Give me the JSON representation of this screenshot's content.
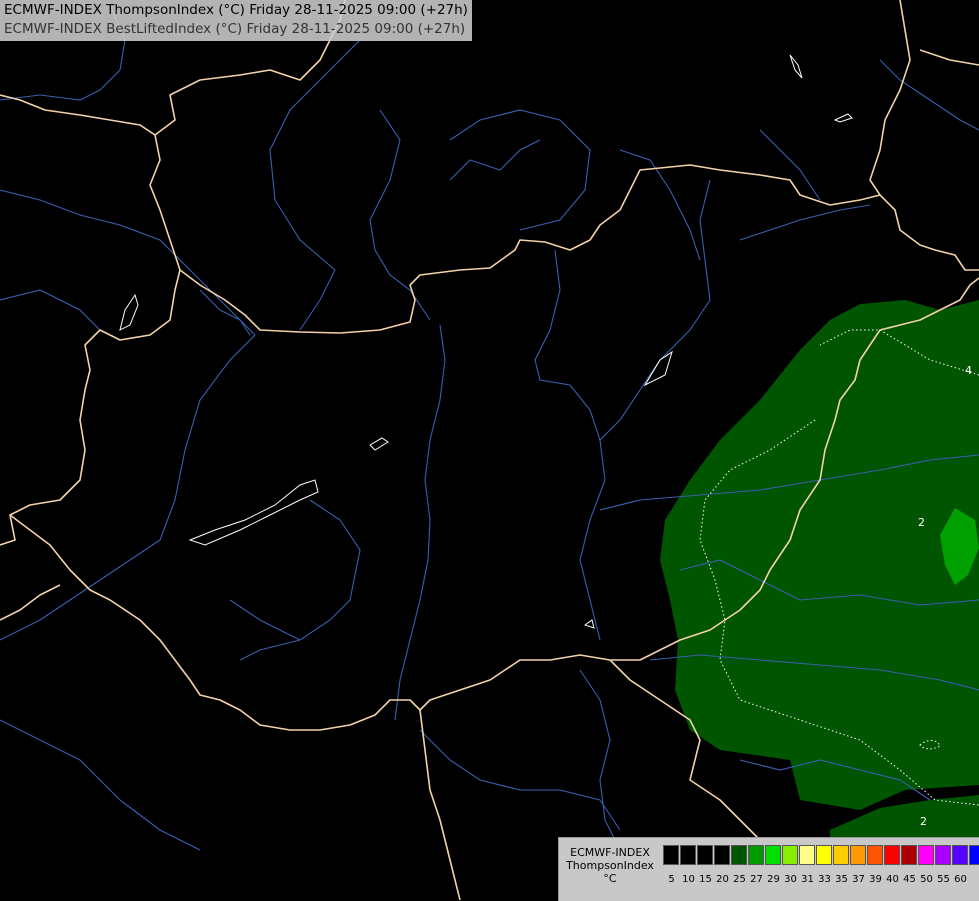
{
  "title": {
    "line1": "ECMWF-INDEX ThompsonIndex (°C) Friday 28-11-2025 09:00 (+27h)",
    "line2": "ECMWF-INDEX BestLiftedIndex (°C) Friday 28-11-2025 09:00 (+27h)"
  },
  "contour_labels": [
    "4",
    "2",
    "2"
  ],
  "legend": {
    "label_line1": "ECMWF-INDEX",
    "label_line2": "ThompsonIndex",
    "label_line3": "°C",
    "ticks": [
      "5",
      "10",
      "15",
      "20",
      "25",
      "27",
      "29",
      "30",
      "31",
      "33",
      "35",
      "37",
      "39",
      "40",
      "45",
      "50",
      "55",
      "60"
    ],
    "colors": [
      "#000000",
      "#000000",
      "#000000",
      "#000000",
      "#005500",
      "#009900",
      "#00dd00",
      "#88ee00",
      "#ffff88",
      "#ffff00",
      "#ffcc00",
      "#ff9900",
      "#ff5500",
      "#ff0000",
      "#aa0000",
      "#ff00ff",
      "#aa00ff",
      "#5500ff",
      "#0000ff"
    ]
  },
  "colors": {
    "background": "#000000",
    "border": "#f3d2a8",
    "river": "#3a5fae",
    "field_dark": "#005500",
    "field_light": "#00a000"
  }
}
